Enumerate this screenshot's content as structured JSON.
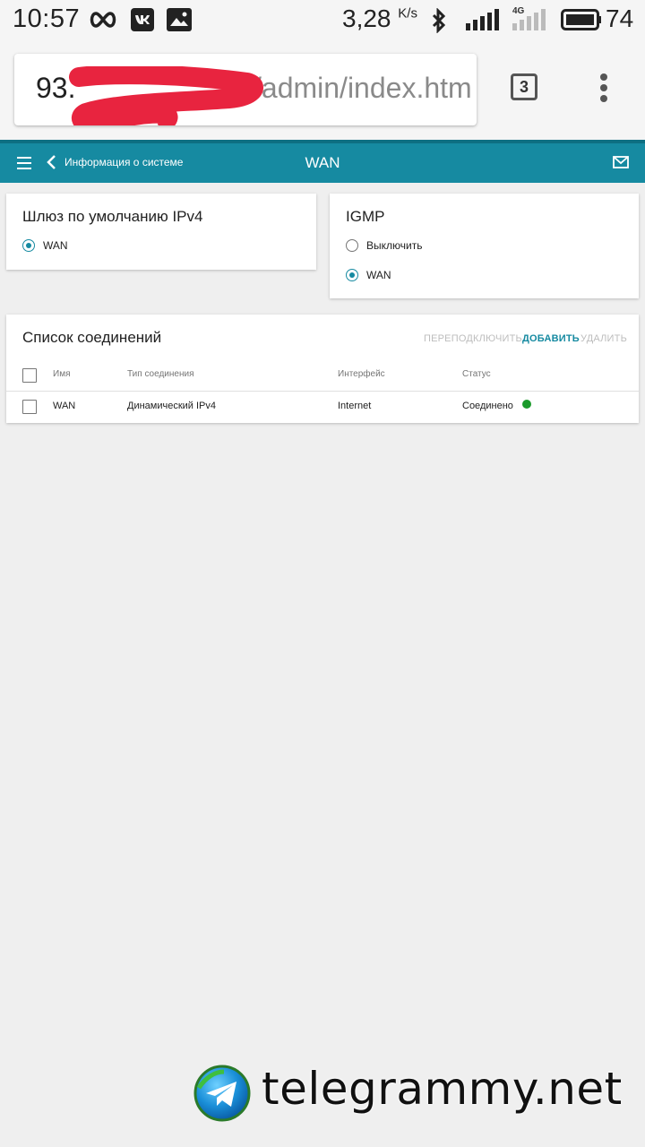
{
  "status_bar": {
    "time": "10:57",
    "net_speed": "3,28",
    "net_unit": "K/s",
    "network_type": "4G",
    "battery": "74",
    "icons": [
      "infinity-icon",
      "vk-icon",
      "gallery-icon",
      "bluetooth-icon",
      "signal-icon",
      "signal-4g-icon",
      "battery-icon"
    ]
  },
  "browser": {
    "url_host": "93.",
    "url_path": "/admin/index.htm",
    "tab_count": "3"
  },
  "header": {
    "back_label": "Информация о системе",
    "title": "WAN",
    "accent": "#168aa1"
  },
  "gateway_card": {
    "title": "Шлюз по умолчанию IPv4",
    "options": [
      {
        "label": "WAN",
        "checked": true
      }
    ]
  },
  "igmp_card": {
    "title": "IGMP",
    "options": [
      {
        "label": "Выключить",
        "checked": false
      },
      {
        "label": "WAN",
        "checked": true
      }
    ]
  },
  "connections": {
    "title": "Список соединений",
    "actions": {
      "reconnect": "ПЕРЕПОДКЛЮЧИТЬ",
      "add": "ДОБАВИТЬ",
      "delete": "УДАЛИТЬ"
    },
    "columns": [
      "Имя",
      "Тип соединения",
      "Интерфейс",
      "Статус"
    ],
    "rows": [
      {
        "name": "WAN",
        "type": "Динамический IPv4",
        "interface": "Internet",
        "status": "Соединено",
        "status_color": "#1a9a2b"
      }
    ]
  },
  "watermark": {
    "text": "telegrammy.net"
  }
}
